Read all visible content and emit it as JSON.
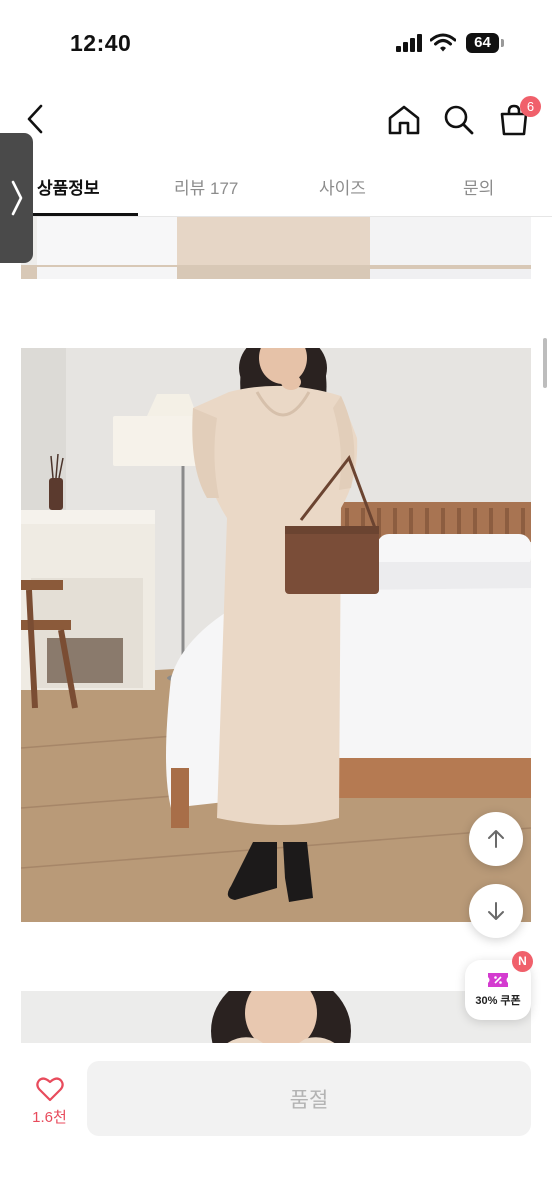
{
  "status_bar": {
    "time": "12:40",
    "battery": "64"
  },
  "cart": {
    "count": "6"
  },
  "tabs": [
    {
      "label": "상품정보"
    },
    {
      "label": "리뷰 177"
    },
    {
      "label": "사이즈"
    },
    {
      "label": "문의"
    }
  ],
  "coupon": {
    "label": "30% 쿠폰",
    "badge": "N"
  },
  "like": {
    "count": "1.6천"
  },
  "purchase": {
    "label": "품절"
  },
  "colors": {
    "accent_red": "#f0606b",
    "soldout_bg": "#f2f2f2",
    "soldout_text": "#b3b3b3",
    "like_red": "#e84b5c"
  }
}
